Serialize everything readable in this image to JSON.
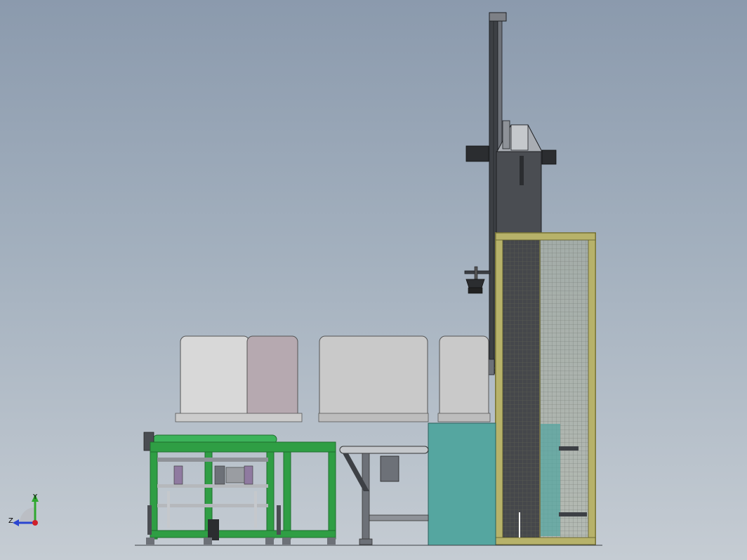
{
  "viewport": {
    "background_top": "#8b9aad",
    "background_bottom": "#c5ccd3"
  },
  "colors": {
    "frame_green": "#2f9e44",
    "frame_green_dark": "#1f6e2e",
    "teal_panel": "#55a6a0",
    "guard_frame": "#b7b26a",
    "tower_dark": "#4a4d52",
    "box_white": "#d8d8d8",
    "box_pink": "#b6a9b0"
  },
  "triad": {
    "x_label": "",
    "y_label": "Y",
    "z_label": "Z",
    "x_color": "#d0202a",
    "y_color": "#2fa82f",
    "z_color": "#2a45d0"
  }
}
